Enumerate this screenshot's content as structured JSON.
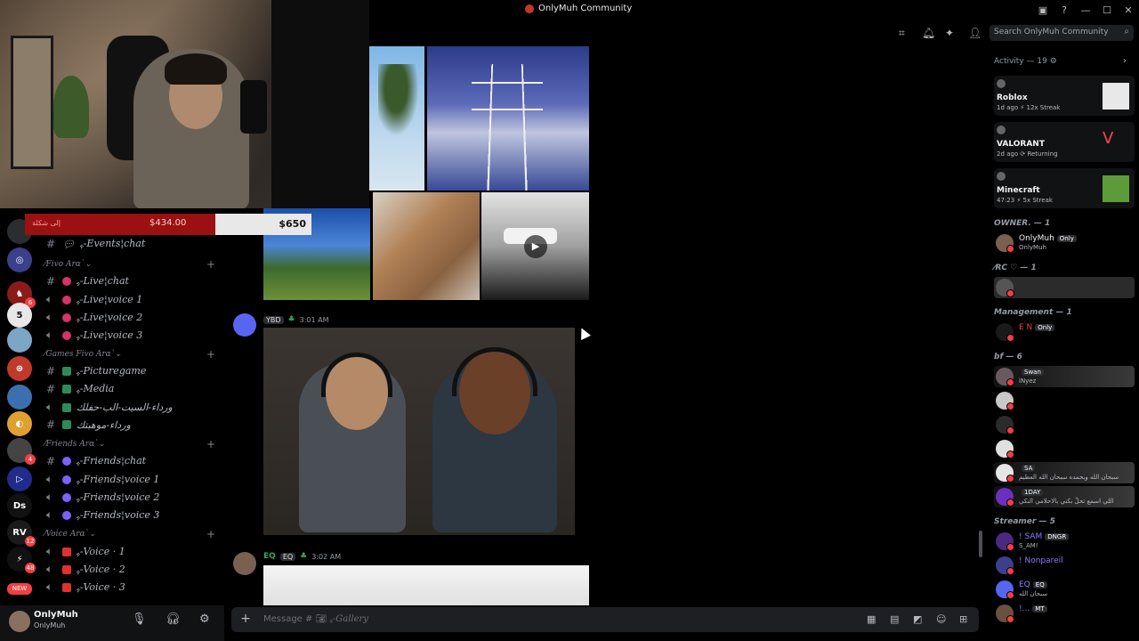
{
  "window": {
    "title": "OnlyMuh Community",
    "controls": [
      "—",
      "☐",
      "✕"
    ]
  },
  "donation": {
    "label": "إلى شكلة",
    "raised": "$434.00",
    "goal": "$650"
  },
  "rail": {
    "servers": [
      {
        "name": "server-1",
        "color": "#2b2d31",
        "glyph": "",
        "badge": ""
      },
      {
        "name": "server-2",
        "color": "#3b3f8c",
        "glyph": "◎",
        "badge": ""
      },
      {
        "name": "server-3",
        "color": "#8b1a1a",
        "glyph": "♞",
        "badge": "6"
      },
      {
        "name": "server-4",
        "color": "#e8e8e8",
        "glyph": "5",
        "badge": ""
      },
      {
        "name": "server-5",
        "color": "#7da6c4",
        "glyph": "",
        "badge": ""
      },
      {
        "name": "server-6",
        "color": "#c0392b",
        "glyph": "⊛",
        "badge": ""
      },
      {
        "name": "server-7",
        "color": "#3c6fb0",
        "glyph": "",
        "badge": ""
      },
      {
        "name": "server-8",
        "color": "#e0a030",
        "glyph": "◐",
        "badge": ""
      },
      {
        "name": "server-9",
        "color": "#444",
        "glyph": "",
        "badge": "4"
      },
      {
        "name": "server-10",
        "color": "#202b8c",
        "glyph": "▷",
        "badge": ""
      },
      {
        "name": "server-11",
        "color": "#111",
        "glyph": "Ds",
        "badge": ""
      },
      {
        "name": "server-12",
        "color": "#1a1a1a",
        "glyph": "RV",
        "badge": "12"
      },
      {
        "name": "server-13",
        "color": "#111",
        "glyph": "⚡",
        "badge": "48"
      }
    ],
    "new_label": "NEW"
  },
  "channels": {
    "top_channel": "ﮩ-Events¦chat",
    "categories": [
      {
        "label": "⁄Fivo Arɑ`⌄",
        "channels": [
          {
            "type": "text",
            "label": "ﮩ-Live¦chat"
          },
          {
            "type": "voice",
            "label": "ﮩ-Live¦voice 1"
          },
          {
            "type": "voice",
            "label": "ﮩ-Live¦voice 2"
          },
          {
            "type": "voice",
            "label": "ﮩ-Live¦voice 3"
          }
        ]
      },
      {
        "label": "⁄Games Fivo Arɑ`⌄",
        "channels": [
          {
            "type": "text",
            "label": "ﮩ-Picturegame"
          },
          {
            "type": "text",
            "label": "ﮩ-Media"
          },
          {
            "type": "voice",
            "label": "ورداء-السيت-الب-حفلك"
          },
          {
            "type": "text",
            "label": "ورداء-موهبتك"
          }
        ]
      },
      {
        "label": "⁄Friends Arɑ`⌄",
        "channels": [
          {
            "type": "text",
            "label": "ﮩ-Friends¦chat"
          },
          {
            "type": "voice",
            "label": "ﮩ-Friends¦voice 1"
          },
          {
            "type": "voice",
            "label": "ﮩ-Friends¦voice 2"
          },
          {
            "type": "voice",
            "label": "ﮩ-Friends¦voice 3"
          }
        ]
      },
      {
        "label": "⁄Voice Arɑ`⌄",
        "channels": [
          {
            "type": "voice",
            "label": "ﮩ-Voice · 1"
          },
          {
            "type": "voice",
            "label": "ﮩ-Voice · 2"
          },
          {
            "type": "voice",
            "label": "ﮩ-Voice · 3"
          }
        ]
      }
    ]
  },
  "user": {
    "name": "OnlyMuh",
    "status": "OnlyMuh"
  },
  "chat": {
    "search_placeholder": "Search OnlyMuh Community",
    "messages": [
      {
        "tag": "YBD",
        "time": "3:01 AM"
      },
      {
        "name": "EQ",
        "tag": "EQ",
        "time": "3:02 AM"
      }
    ],
    "composer_prefix": "Message #",
    "composer_channel": "ﮩ-Gallery"
  },
  "members": {
    "activity_header": "Activity — 19",
    "activities": [
      {
        "game": "Roblox",
        "meta": "1d ago  ⚡ 12x Streak"
      },
      {
        "game": "VALORANT",
        "meta": "2d ago  ⟳ Returning"
      },
      {
        "game": "Minecraft",
        "meta": "47:23  ⚡ 5x Streak"
      }
    ],
    "groups": [
      {
        "label": "OWNER. — 1",
        "members": [
          {
            "name": "OnlyMuh",
            "tag": "Only",
            "sub": "OnlyMuh"
          }
        ]
      },
      {
        "label": "⁄RC ♡ — 1",
        "members": [
          {
            "name": "",
            "tag": "",
            "sub": ""
          }
        ]
      },
      {
        "label": "Management — 1",
        "members": [
          {
            "name": "E N",
            "tag": "Only",
            "sub": ""
          }
        ]
      },
      {
        "label": "bf — 6",
        "members": [
          {
            "name": "",
            "tag": "Swan",
            "sub": "iNyez"
          },
          {
            "name": "",
            "tag": "",
            "sub": ""
          },
          {
            "name": "",
            "tag": "",
            "sub": ""
          },
          {
            "name": "",
            "tag": "",
            "sub": ""
          },
          {
            "name": "",
            "tag": "SA",
            "sub": "سبحان الله وبحمده سبحان الله العظيم"
          },
          {
            "name": "",
            "tag": "1DAY",
            "sub": "اللي اسمع تحلّ بكتي بالاحلامي النكي"
          }
        ]
      },
      {
        "label": "Streamer — 5",
        "members": [
          {
            "name": "! SAM",
            "tag": "DNGR",
            "sub": "S_AM!"
          },
          {
            "name": "! Nonpareil",
            "tag": "",
            "sub": ""
          },
          {
            "name": "EQ",
            "tag": "EQ",
            "sub": "سبحان الله"
          },
          {
            "name": "!...",
            "tag": "MT",
            "sub": ""
          }
        ]
      }
    ]
  },
  "colors": {
    "red": "#f23f43",
    "bg": "#000000",
    "panel": "#111214",
    "accent": "#5865f2"
  }
}
